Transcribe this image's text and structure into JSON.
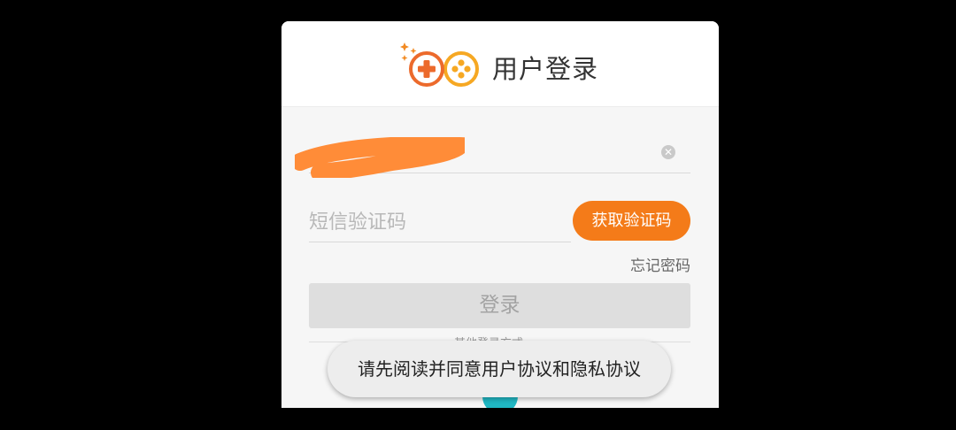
{
  "header": {
    "title": "用户登录",
    "logo_icon": "gamepad-logo-icon"
  },
  "form": {
    "phone": {
      "value": "",
      "clear_icon": "clear-icon"
    },
    "sms_code": {
      "placeholder": "短信验证码"
    },
    "get_code_label": "获取验证码",
    "forgot_password_label": "忘记密码",
    "login_label": "登录",
    "other_login_label": "其他登录方式"
  },
  "toast": {
    "message": "请先阅读并同意用户协议和隐私协议"
  },
  "colors": {
    "accent": "#f47b19",
    "login_disabled": "#dedede",
    "background": "#000000"
  }
}
